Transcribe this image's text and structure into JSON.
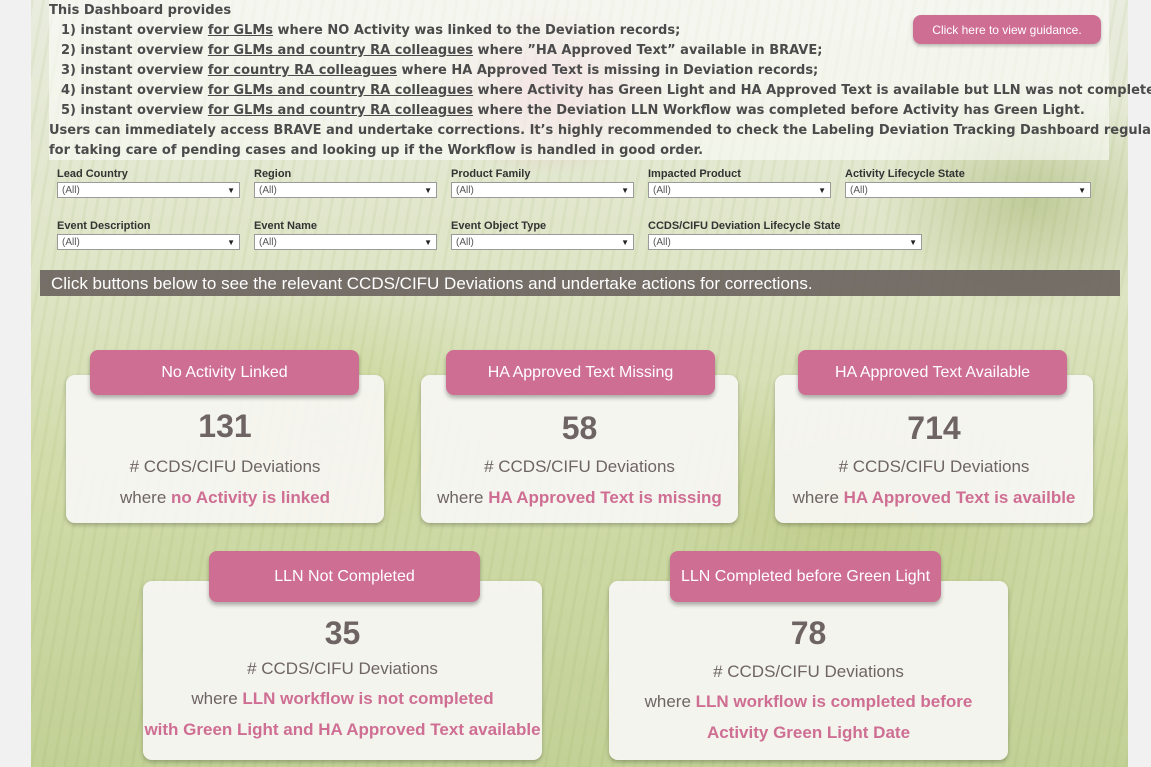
{
  "intro": {
    "heading": "This Dashboard provides",
    "items": [
      {
        "num": "1) instant overview ",
        "link": "for GLMs",
        "rest": " where NO Activity was linked to the Deviation records;"
      },
      {
        "num": "2) instant overview ",
        "link": "for GLMs and country RA colleagues",
        "rest": " where ”HA Approved Text” available in BRAVE;"
      },
      {
        "num": "3) instant overview ",
        "link": "for country RA colleagues",
        "rest": " where HA Approved Text is missing in Deviation records;"
      },
      {
        "num": "4) instant overview ",
        "link": "for GLMs and country RA colleagues",
        "rest": " where Activity has Green Light and HA Approved Text is available but LLN was not completed;"
      },
      {
        "num": "5) instant overview ",
        "link": "for GLMs and country RA colleagues",
        "rest": " where the Deviation LLN Workflow was completed before Activity has Green Light."
      }
    ],
    "footer1": "Users can immediately access BRAVE and undertake corrections. It’s highly recommended to check the Labeling Deviation Tracking Dashboard regularly",
    "footer2": "for taking care of pending cases and looking up if the Workflow is handled in good order."
  },
  "guidance_button": "Click here to view guidance.",
  "filters": [
    {
      "label": "Lead Country",
      "value": "(All)"
    },
    {
      "label": "Region",
      "value": "(All)"
    },
    {
      "label": "Product Family",
      "value": "(All)"
    },
    {
      "label": "Impacted Product",
      "value": "(All)"
    },
    {
      "label": "Activity Lifecycle State",
      "value": "(All)"
    },
    {
      "label": "Event Description",
      "value": "(All)"
    },
    {
      "label": "Event Name",
      "value": "(All)"
    },
    {
      "label": "Event Object Type",
      "value": "(All)"
    },
    {
      "label": "CCDS/CIFU Deviation Lifecycle State",
      "value": "(All)"
    }
  ],
  "banner": "Click buttons below to see the relevant CCDS/CIFU Deviations and undertake actions for corrections.",
  "cards": [
    {
      "button": "No Activity Linked",
      "count": "131",
      "subtitle": "# CCDS/CIFU Deviations",
      "where": "where ",
      "highlight": "no Activity is linked"
    },
    {
      "button": "HA Approved Text Missing",
      "count": "58",
      "subtitle": "# CCDS/CIFU Deviations",
      "where": "where ",
      "highlight": "HA Approved Text is missing"
    },
    {
      "button": "HA Approved Text Available",
      "count": "714",
      "subtitle": "# CCDS/CIFU Deviations",
      "where": "where ",
      "highlight": "HA Approved Text is availble"
    },
    {
      "button": "LLN Not Completed",
      "count": "35",
      "subtitle": "# CCDS/CIFU Deviations",
      "where": "where ",
      "highlight": "LLN workflow is not completed",
      "highlight2": "with Green Light and HA Approved Text available"
    },
    {
      "button": "LLN Completed before Green Light",
      "count": "78",
      "subtitle": "# CCDS/CIFU Deviations",
      "where": "where ",
      "highlight": "LLN workflow is completed before",
      "highlight2": "Activity Green Light Date"
    }
  ],
  "colors": {
    "accent": "#cf6e93",
    "banner": "#645a58",
    "count_text": "#6e6464"
  }
}
